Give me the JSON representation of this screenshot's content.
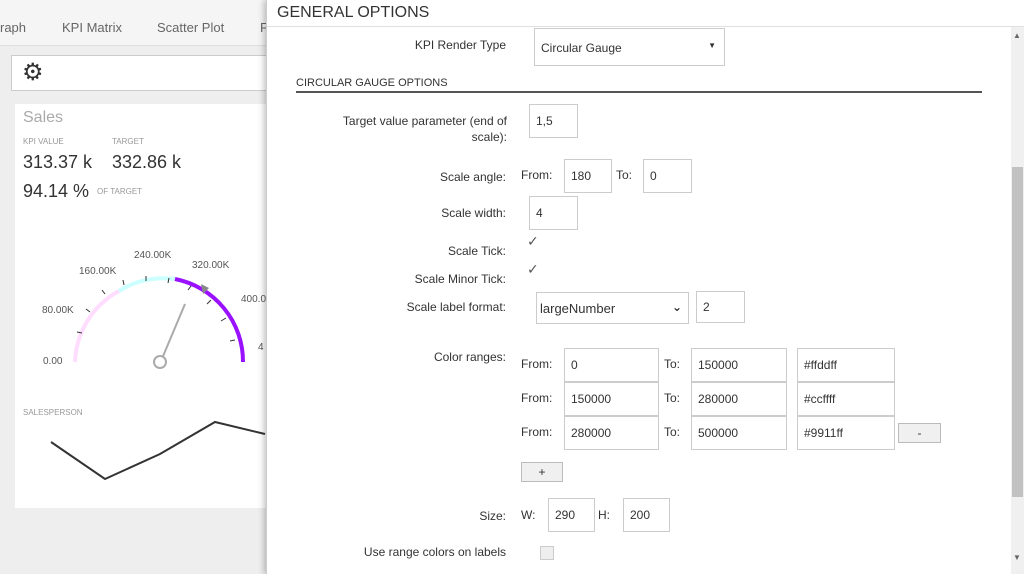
{
  "background": {
    "tabs": [
      "raph",
      "KPI Matrix",
      "Scatter Plot",
      "F"
    ],
    "card": {
      "title": "Sales",
      "kpi_value_label": "KPI VALUE",
      "target_label": "TARGET",
      "kpi_value": "313.37 k",
      "target_value": "332.86 k",
      "percent": "94.14 %",
      "of_target_label": "OF TARGET",
      "gauge_labels": [
        "0.00",
        "80.00K",
        "160.00K",
        "240.00K",
        "320.00K",
        "400.0",
        "4"
      ],
      "salesperson_label": "SALESPERSON"
    }
  },
  "dialog": {
    "title": "GENERAL OPTIONS",
    "kpi_render_type_label": "KPI Render Type",
    "kpi_render_type_value": "Circular Gauge",
    "section_title": "CIRCULAR GAUGE OPTIONS",
    "target_value_label": "Target value parameter (end of scale):",
    "target_value": "1,5",
    "scale_angle_label": "Scale angle:",
    "from_label": "From:",
    "to_label": "To:",
    "scale_angle_from": "180",
    "scale_angle_to": "0",
    "scale_width_label": "Scale width:",
    "scale_width": "4",
    "scale_tick_label": "Scale Tick:",
    "scale_tick_checked": true,
    "scale_minor_tick_label": "Scale Minor Tick:",
    "scale_minor_tick_checked": true,
    "scale_label_format_label": "Scale label format:",
    "scale_label_format_value": "largeNumber",
    "scale_label_decimals": "2",
    "color_ranges_label": "Color ranges:",
    "color_ranges": [
      {
        "from": "0",
        "to": "150000",
        "color": "#ffddff"
      },
      {
        "from": "150000",
        "to": "280000",
        "color": "#ccffff"
      },
      {
        "from": "280000",
        "to": "500000",
        "color": "#9911ff"
      }
    ],
    "remove_button_label": "-",
    "add_button_label": "+",
    "size_label": "Size:",
    "width_label": "W:",
    "height_label": "H:",
    "size_w": "290",
    "size_h": "200",
    "use_range_colors_label": "Use range colors on labels",
    "use_range_colors_checked": false
  }
}
